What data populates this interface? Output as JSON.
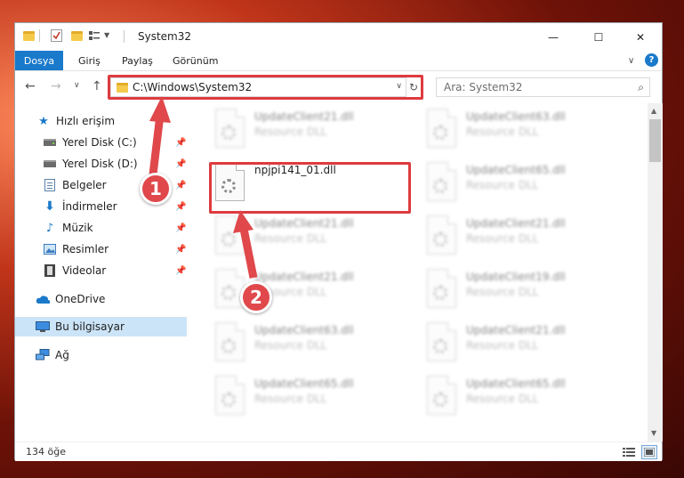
{
  "window": {
    "title": "System32"
  },
  "title_controls": {
    "minimize": "—",
    "maximize": "☐",
    "close": "✕"
  },
  "ribbon": {
    "tabs": [
      "Dosya",
      "Giriş",
      "Paylaş",
      "Görünüm"
    ],
    "expand_icon": "∨",
    "help": "?"
  },
  "nav": {
    "back": "←",
    "forward": "→",
    "recent": "∨",
    "up": "↑",
    "address": "C:\\Windows\\System32",
    "address_dropdown": "∨",
    "refresh": "↻",
    "search_placeholder": "Ara: System32",
    "search_icon": "⌕"
  },
  "sidebar": {
    "quick_access": "Hızlı erişim",
    "pinned": [
      {
        "label": "Yerel Disk (C:)",
        "icon": "drive-icon"
      },
      {
        "label": "Yerel Disk (D:)",
        "icon": "drive-icon"
      },
      {
        "label": "Belgeler",
        "icon": "documents-icon"
      },
      {
        "label": "İndirmeler",
        "icon": "downloads-icon"
      },
      {
        "label": "Müzik",
        "icon": "music-icon"
      },
      {
        "label": "Resimler",
        "icon": "pictures-icon"
      },
      {
        "label": "Videolar",
        "icon": "videos-icon"
      }
    ],
    "onedrive": "OneDrive",
    "this_pc": "Bu bilgisayar",
    "network": "Ağ"
  },
  "files": [
    {
      "name": "UpdateClient21.dll",
      "type": "Resource DLL"
    },
    {
      "name": "UpdateClient63.dll",
      "type": "Resource DLL"
    },
    {
      "name": "npjpi141_01.dll",
      "type": ""
    },
    {
      "name": "UpdateClient65.dll",
      "type": "Resource DLL"
    },
    {
      "name": "UpdateClient21.dll",
      "type": "Resource DLL"
    },
    {
      "name": "UpdateClient21.dll",
      "type": "Resource DLL"
    },
    {
      "name": "UpdateClient21.dll",
      "type": "Resource DLL"
    },
    {
      "name": "UpdateClient19.dll",
      "type": "Resource DLL"
    },
    {
      "name": "UpdateClient63.dll",
      "type": "Resource DLL"
    },
    {
      "name": "UpdateClient21.dll",
      "type": "Resource DLL"
    },
    {
      "name": "UpdateClient65.dll",
      "type": "Resource DLL"
    },
    {
      "name": "UpdateClient65.dll",
      "type": "Resource DLL"
    }
  ],
  "status": {
    "item_count": "134 öğe"
  },
  "annotations": {
    "step1": "1",
    "step2": "2",
    "color": "#de3b3f"
  }
}
